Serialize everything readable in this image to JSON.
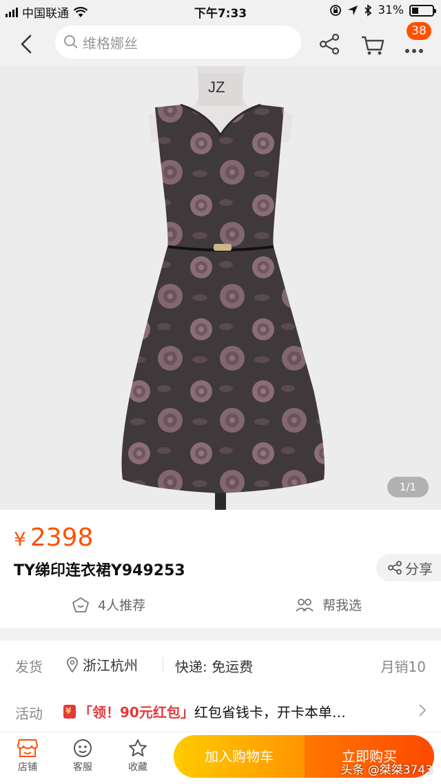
{
  "status_bar": {
    "carrier": "中国联通",
    "time": "下午7:33",
    "battery_text": "31%",
    "battery_level": 0.31
  },
  "navbar": {
    "search_placeholder": "维格娜丝",
    "cart_badge": "38"
  },
  "product_image": {
    "mannequin_label": "JZ",
    "counter": "1/1"
  },
  "product": {
    "currency": "¥",
    "price": "2398",
    "title": "TY绨印连衣裙Y949253",
    "share_label": "分享",
    "recommend_label": "4人推荐",
    "help_choose_label": "帮我选"
  },
  "shipping": {
    "label": "发货",
    "location": "浙江杭州",
    "express": "快递: 免运费",
    "monthly_sales": "月销10"
  },
  "promo": {
    "label": "活动",
    "tag": "「领！90元红包」",
    "text": "红包省钱卡，开卡本单…"
  },
  "bottom_bar": {
    "shop_label": "店铺",
    "service_label": "客服",
    "favorite_label": "收藏",
    "add_to_cart_label": "加入购物车",
    "buy_now_label": "立即购买"
  },
  "watermark": "头条 @桀桀3743",
  "colors": {
    "accent": "#ff5000",
    "cart_gradient_start": "#ffcb00",
    "cart_gradient_end": "#ff9402",
    "buy_gradient_start": "#ff7700",
    "buy_gradient_end": "#ff4900",
    "promo_red": "#e4393c"
  }
}
